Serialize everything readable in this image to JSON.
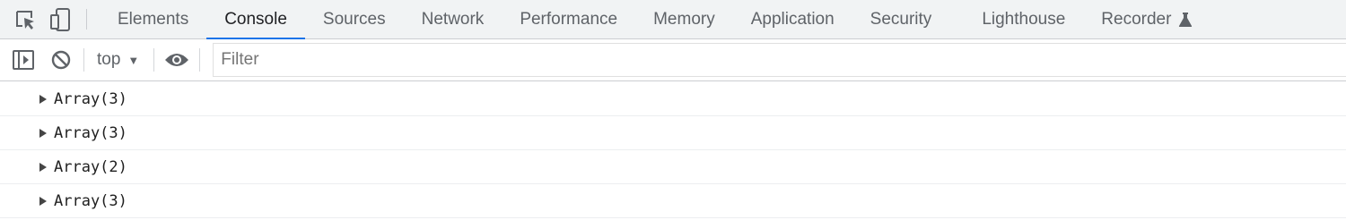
{
  "tabs": [
    {
      "label": "Elements"
    },
    {
      "label": "Console"
    },
    {
      "label": "Sources"
    },
    {
      "label": "Network"
    },
    {
      "label": "Performance"
    },
    {
      "label": "Memory"
    },
    {
      "label": "Application"
    },
    {
      "label": "Security"
    },
    {
      "label": "Lighthouse"
    },
    {
      "label": "Recorder"
    }
  ],
  "active_tab": "Console",
  "toolbar": {
    "context_label": "top",
    "filter_placeholder": "Filter"
  },
  "console": {
    "entries": [
      {
        "text": "Array(3)"
      },
      {
        "text": "Array(3)"
      },
      {
        "text": "Array(2)"
      },
      {
        "text": "Array(3)"
      }
    ]
  },
  "colors": {
    "accent": "#1a73e8",
    "tabbar_bg": "#f1f3f4"
  },
  "icons": [
    "inspect-element-icon",
    "device-toolbar-icon",
    "flask-icon",
    "sidebar-toggle-icon",
    "clear-console-icon",
    "eye-icon"
  ]
}
